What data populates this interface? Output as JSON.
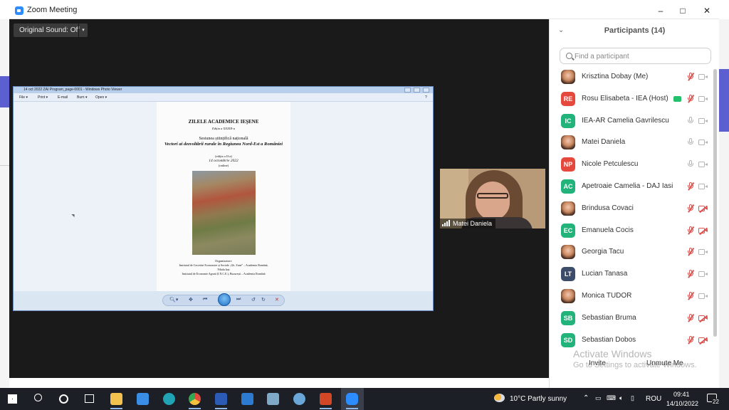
{
  "window": {
    "title": "Zoom Meeting",
    "minimize": "–",
    "maximize": "□",
    "close": "✕"
  },
  "toolbar": {
    "original_sound": "Original Sound: Off",
    "dropdown": "▾"
  },
  "photo_viewer": {
    "title": "14 oct 2022 ZAI Program_page-0001 - Windows Photo Viewer",
    "menu": [
      "File ▾",
      "Print ▾",
      "E-mail",
      "Burn ▾",
      "Open ▾"
    ],
    "help": "?"
  },
  "document": {
    "title": "ZILELE ACADEMICE IEŞENE",
    "edition": "Ediția a XXXIII-a",
    "session": "Sesiunea științifică națională",
    "theme": "Vectori ai dezvoltării rurale în Regiunea Nord-Est a României",
    "edition2": "(ediția a II-a)",
    "date": "14 octombrie 2022",
    "mode": "(online)",
    "organizers_title": "Organizatori:",
    "org1": "Institutul de Cercetări Economice și Sociale „Gh. Zane” – Academia Română,",
    "org2": "Filiala Iași",
    "org3": "Institutul de Economie Agrară (I.N.C.E.), București – Academia Română"
  },
  "video": {
    "name": "Matei Daniela"
  },
  "participants": {
    "title": "Participants (14)",
    "search_placeholder": "Find a participant",
    "list": [
      {
        "name": "Krisztina Dobay (Me)",
        "initials": "",
        "color": "",
        "mic": "muted",
        "cam": "on"
      },
      {
        "name": "Rosu Elisabeta - IEA (Host)",
        "initials": "RE",
        "color": "#e5493d",
        "mic": "muted",
        "cam": "on",
        "sharing": true
      },
      {
        "name": "IEA-AR Camelia Gavrilescu",
        "initials": "IC",
        "color": "#22b37b",
        "mic": "on",
        "cam": "on"
      },
      {
        "name": "Matei Daniela",
        "initials": "",
        "color": "",
        "mic": "on",
        "cam": "on"
      },
      {
        "name": "Nicole Petculescu",
        "initials": "NP",
        "color": "#e5493d",
        "mic": "on",
        "cam": "on"
      },
      {
        "name": "Apetroaie Camelia - DAJ Iasi",
        "initials": "AC",
        "color": "#22b37b",
        "mic": "muted",
        "cam": "on"
      },
      {
        "name": "Brindusa Covaci",
        "initials": "",
        "color": "",
        "mic": "muted",
        "cam": "off"
      },
      {
        "name": "Emanuela Cocis",
        "initials": "EC",
        "color": "#22b37b",
        "mic": "muted",
        "cam": "off"
      },
      {
        "name": "Georgia Tacu",
        "initials": "",
        "color": "",
        "mic": "muted",
        "cam": "on"
      },
      {
        "name": "Lucian Tanasa",
        "initials": "LT",
        "color": "#3c4d6b",
        "mic": "muted",
        "cam": "on"
      },
      {
        "name": "Monica TUDOR",
        "initials": "",
        "color": "",
        "mic": "muted",
        "cam": "on"
      },
      {
        "name": "Sebastian Bruma",
        "initials": "SB",
        "color": "#22b37b",
        "mic": "muted",
        "cam": "off"
      },
      {
        "name": "Sebastian Dobos",
        "initials": "SD",
        "color": "#22b37b",
        "mic": "muted",
        "cam": "off"
      }
    ],
    "invite": "Invite",
    "unmute": "Unmute Me"
  },
  "watermark": {
    "line1": "Activate Windows",
    "line2": "Go to Settings to activate Windows."
  },
  "taskbar": {
    "weather": "10°C  Partly sunny",
    "lang": "ROU",
    "time": "09:41",
    "date": "14/10/2022",
    "notifications": "22"
  }
}
